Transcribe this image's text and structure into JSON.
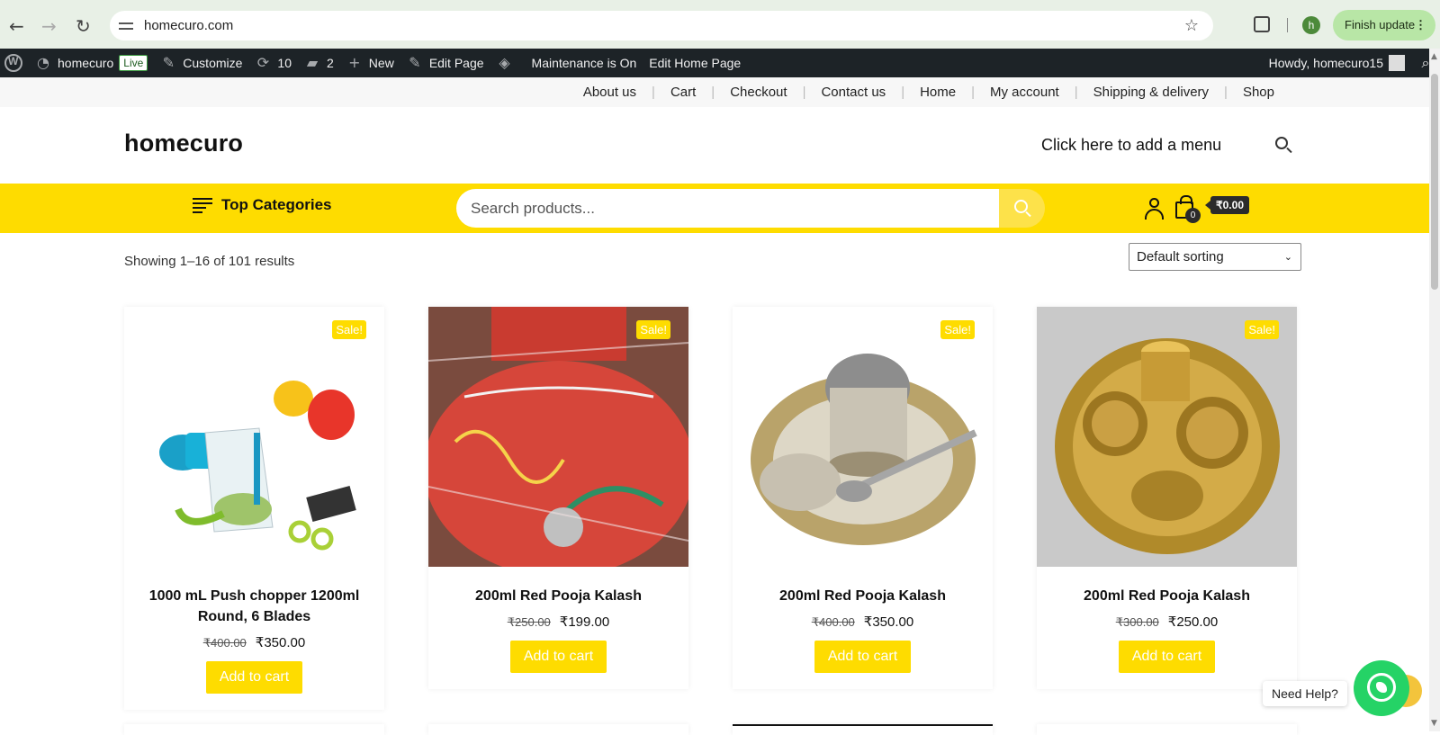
{
  "browser": {
    "url": "homecuro.com",
    "profile_initial": "h",
    "finish_update": "Finish update"
  },
  "adminbar": {
    "site": "homecuro",
    "live": "Live",
    "customize": "Customize",
    "updates": "10",
    "comments": "2",
    "new": "New",
    "edit_page": "Edit Page",
    "maintenance": "Maintenance is On",
    "edit_home": "Edit Home Page",
    "howdy": "Howdy, homecuro15"
  },
  "topnav": [
    "About us",
    "Cart",
    "Checkout",
    "Contact us",
    "Home",
    "My account",
    "Shipping & delivery",
    "Shop"
  ],
  "header": {
    "logo": "homecuro",
    "add_menu": "Click here to add a menu"
  },
  "bar": {
    "top_categories": "Top Categories",
    "search_placeholder": "Search products...",
    "cart_count": "0",
    "cart_total": "₹0.00"
  },
  "shop": {
    "results": "Showing 1–16 of 101 results",
    "sorting": "Default sorting"
  },
  "products": [
    {
      "title": "1000 mL Push chopper 1200ml Round, 6 Blades",
      "old_price": "₹400.00",
      "price": "₹350.00",
      "sale": "Sale!",
      "button": "Add to cart"
    },
    {
      "title": "200ml Red Pooja Kalash",
      "old_price": "₹250.00",
      "price": "₹199.00",
      "sale": "Sale!",
      "button": "Add to cart"
    },
    {
      "title": "200ml Red Pooja Kalash",
      "old_price": "₹400.00",
      "price": "₹350.00",
      "sale": "Sale!",
      "button": "Add to cart"
    },
    {
      "title": "200ml Red Pooja Kalash",
      "old_price": "₹300.00",
      "price": "₹250.00",
      "sale": "Sale!",
      "button": "Add to cart"
    }
  ],
  "help": {
    "label": "Need Help?"
  },
  "colors": {
    "accent": "#fedc00",
    "adminbar": "#1d2327",
    "whatsapp": "#25d366"
  }
}
